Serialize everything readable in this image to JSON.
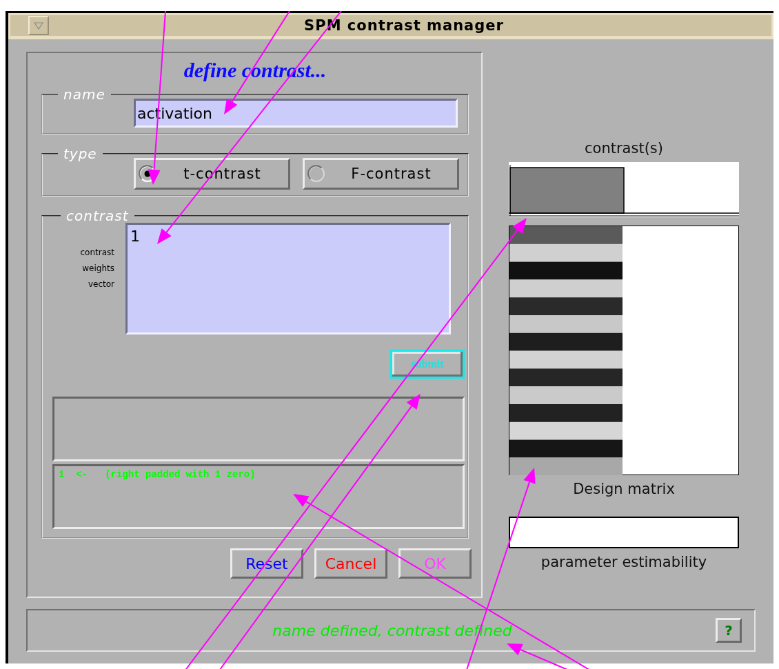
{
  "window": {
    "title": "SPM contrast manager"
  },
  "heading": "define contrast...",
  "name_group": {
    "legend": "name",
    "value": "activation"
  },
  "type_group": {
    "legend": "type",
    "options": [
      {
        "label": "t-contrast",
        "selected": true
      },
      {
        "label": "F-contrast",
        "selected": false
      }
    ]
  },
  "contrast_group": {
    "legend": "contrast",
    "field_label": "contrast weights vector",
    "value": "1",
    "submit": "submit",
    "messages": [
      "1  <-   (right padded with 1 zero)"
    ]
  },
  "buttons": [
    {
      "label": "Reset",
      "color": "#0000ff"
    },
    {
      "label": "Cancel",
      "color": "#ff0000"
    },
    {
      "label": "OK",
      "color": "#ff44ff"
    }
  ],
  "right_panel": {
    "contrasts_title": "contrast(s)",
    "design_title": "Design matrix",
    "estimability_title": "parameter estimability"
  },
  "status_bar": {
    "message": "name defined, contrast defined",
    "help": "?"
  }
}
